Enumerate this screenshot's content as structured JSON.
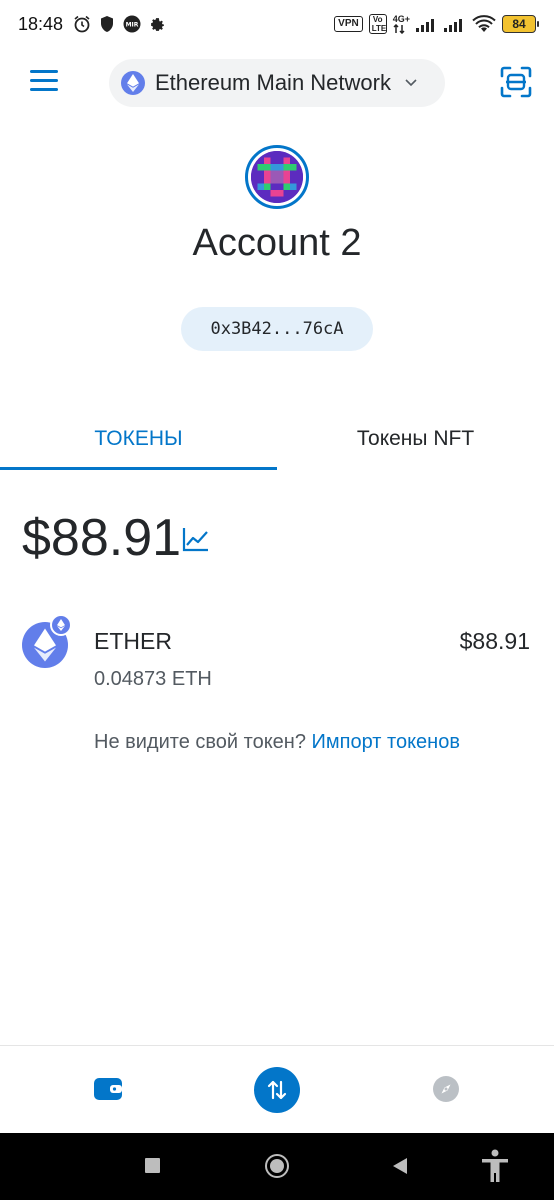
{
  "status_bar": {
    "time": "18:48",
    "vpn_label": "VPN",
    "volte_label": "Vo LTE",
    "network_label": "4G+",
    "battery_level": "84"
  },
  "header": {
    "network_name": "Ethereum Main Network"
  },
  "account": {
    "name": "Account 2",
    "address": "0x3B42...76cA"
  },
  "tabs": [
    {
      "label": "ТОКЕНЫ",
      "active": true
    },
    {
      "label": "Токены NFT",
      "active": false
    }
  ],
  "balance": {
    "total": "$88.91"
  },
  "tokens": [
    {
      "name": "ETHER",
      "amount": "0.04873 ETH",
      "fiat": "$88.91",
      "icon": "ethereum-icon"
    }
  ],
  "import": {
    "prompt": "Не видите свой токен?",
    "link": "Импорт токенов"
  },
  "colors": {
    "accent": "#0376c9",
    "ethereum": "#627eea",
    "address_bg": "#e4f0fa",
    "battery": "#f2c230"
  }
}
